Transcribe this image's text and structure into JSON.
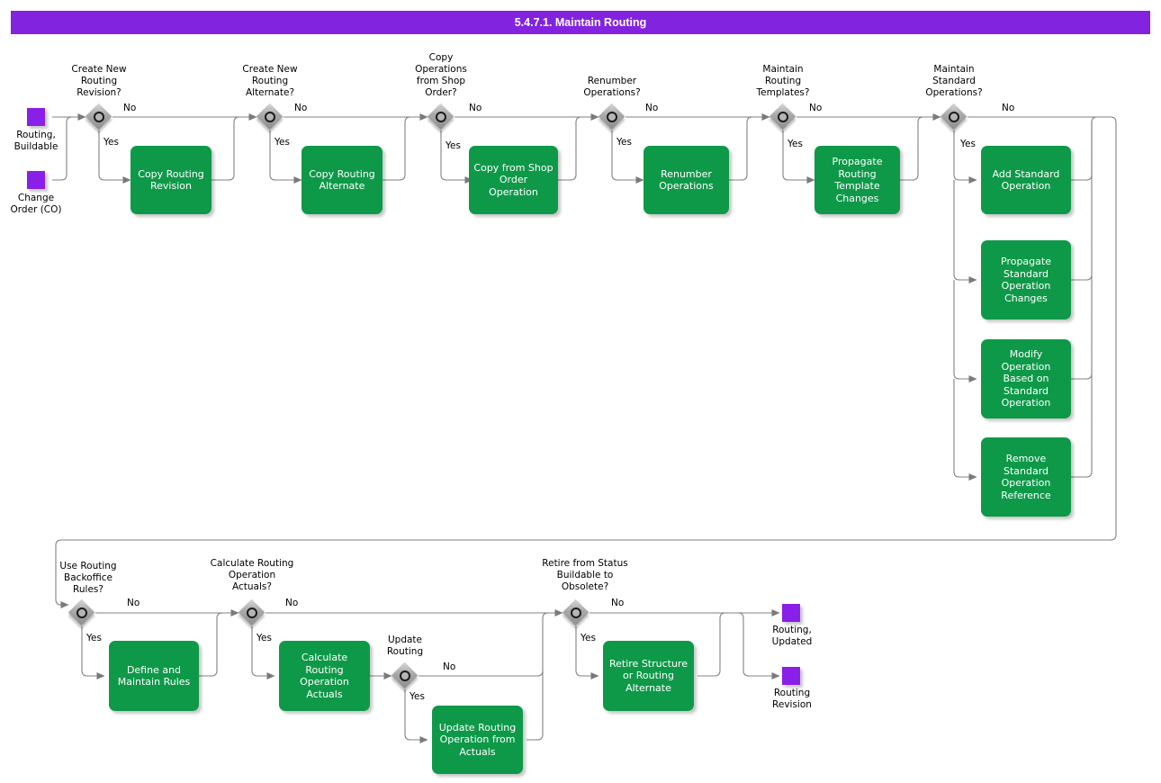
{
  "title": "5.4.7.1. Maintain Routing",
  "colors": {
    "header_purple": "#8223e0",
    "terminator_purple": "#8a1fe8",
    "task_green": "#0e9949",
    "wire_gray": "#808080",
    "text_white": "#ffffff",
    "text_black": "#000000"
  },
  "labels": {
    "yes": "Yes",
    "no": "No"
  },
  "start_terminators": [
    {
      "id": "routing-buildable",
      "label": "Routing,\nBuildable"
    },
    {
      "id": "change-order",
      "label": "Change\nOrder (CO)"
    }
  ],
  "end_terminators": [
    {
      "id": "routing-updated",
      "label": "Routing,\nUpdated"
    },
    {
      "id": "routing-revision",
      "label": "Routing\nRevision"
    }
  ],
  "decisions": [
    {
      "id": "create-new-routing-revision",
      "label": "Create New\nRouting\nRevision?"
    },
    {
      "id": "create-new-routing-alternate",
      "label": "Create New\nRouting\nAlternate?"
    },
    {
      "id": "copy-operations-from-shop-order",
      "label": "Copy\nOperations\nfrom Shop\nOrder?"
    },
    {
      "id": "renumber-operations",
      "label": "Renumber\nOperations?"
    },
    {
      "id": "maintain-routing-templates",
      "label": "Maintain\nRouting\nTemplates?"
    },
    {
      "id": "maintain-standard-operations",
      "label": "Maintain\nStandard\nOperations?"
    },
    {
      "id": "use-routing-backoffice-rules",
      "label": "Use Routing\nBackoffice\nRules?"
    },
    {
      "id": "calculate-routing-operation-actuals",
      "label": "Calculate Routing\nOperation\nActuals?"
    },
    {
      "id": "update-routing",
      "label": "Update\nRouting"
    },
    {
      "id": "retire-from-status-buildable-to-obsolete",
      "label": "Retire from Status\nBuildable to\nObsolete?"
    }
  ],
  "tasks": [
    {
      "id": "copy-routing-revision",
      "label": "Copy Routing\nRevision"
    },
    {
      "id": "copy-routing-alternate",
      "label": "Copy Routing\nAlternate"
    },
    {
      "id": "copy-from-shop-order-operation",
      "label": "Copy from Shop\nOrder Operation"
    },
    {
      "id": "renumber-operations",
      "label": "Renumber\nOperations"
    },
    {
      "id": "propagate-routing-template-changes",
      "label": "Propagate\nRouting\nTemplate\nChanges"
    },
    {
      "id": "add-standard-operation",
      "label": "Add Standard\nOperation"
    },
    {
      "id": "propagate-standard-operation-changes",
      "label": "Propagate\nStandard\nOperation\nChanges"
    },
    {
      "id": "modify-operation-based-on-standard-operation",
      "label": "Modify\nOperation Based\non Standard\nOperation"
    },
    {
      "id": "remove-standard-operation-reference",
      "label": "Remove\nStandard\nOperation\nReference"
    },
    {
      "id": "define-and-maintain-rules",
      "label": "Define and\nMaintain Rules"
    },
    {
      "id": "calculate-routing-operation-actuals",
      "label": "Calculate\nRouting\nOperation\nActuals"
    },
    {
      "id": "update-routing-operation-from-actuals",
      "label": "Update Routing\nOperation from\nActuals"
    },
    {
      "id": "retire-structure-or-routing-alternate",
      "label": "Retire Structure\nor Routing\nAlternate"
    }
  ]
}
